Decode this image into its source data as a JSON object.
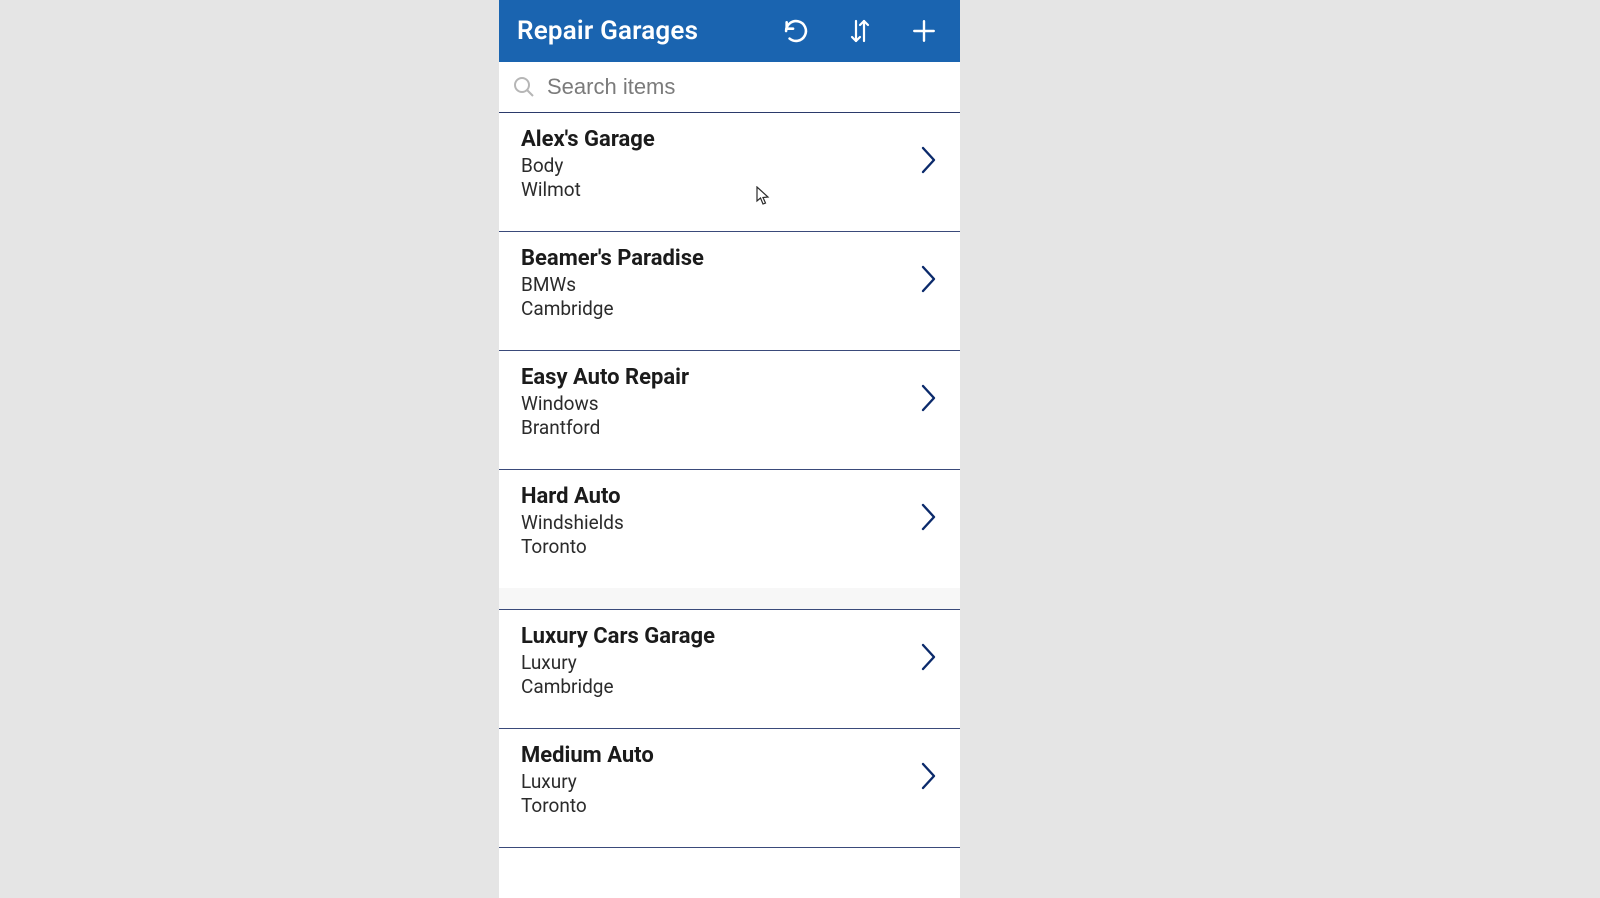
{
  "header": {
    "title": "Repair Garages"
  },
  "search": {
    "placeholder": "Search items",
    "value": ""
  },
  "colors": {
    "headerBg": "#1a64b0",
    "chevron": "#0b2a6b"
  },
  "items": [
    {
      "title": "Alex's Garage",
      "subtitle": "Body",
      "location": "Wilmot",
      "groupEnd": false
    },
    {
      "title": "Beamer's Paradise",
      "subtitle": "BMWs",
      "location": "Cambridge",
      "groupEnd": false
    },
    {
      "title": "Easy Auto Repair",
      "subtitle": "Windows",
      "location": "Brantford",
      "groupEnd": false
    },
    {
      "title": "Hard Auto",
      "subtitle": "Windshields",
      "location": "Toronto",
      "groupEnd": true
    },
    {
      "title": "Luxury Cars Garage",
      "subtitle": "Luxury",
      "location": "Cambridge",
      "groupEnd": false
    },
    {
      "title": "Medium Auto",
      "subtitle": "Luxury",
      "location": "Toronto",
      "groupEnd": false
    }
  ]
}
